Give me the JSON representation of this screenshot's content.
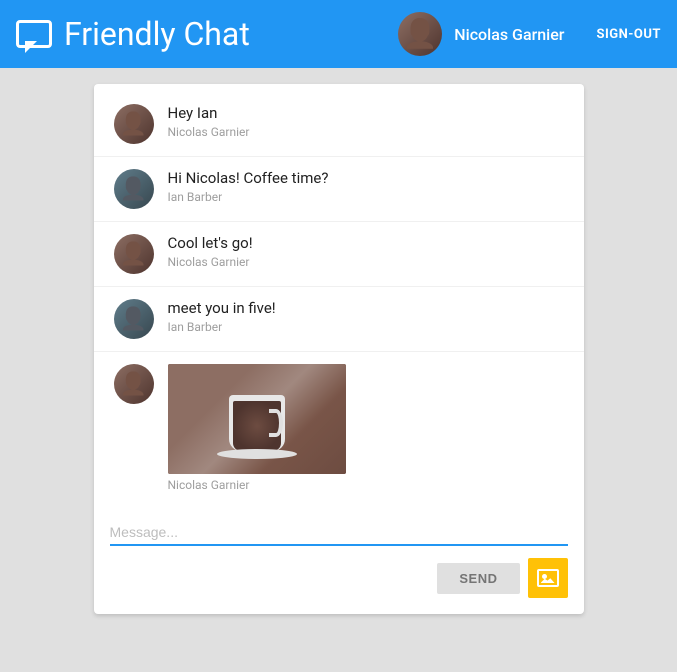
{
  "header": {
    "icon_label": "chat-icon",
    "title": "Friendly Chat",
    "user": {
      "name": "Nicolas Garnier",
      "avatar_label": "nicolas-avatar"
    },
    "sign_out_label": "SIGN-OUT"
  },
  "messages": [
    {
      "id": 1,
      "text": "Hey Ian",
      "sender": "Nicolas Garnier",
      "avatar_type": "nicolas"
    },
    {
      "id": 2,
      "text": "Hi Nicolas! Coffee time?",
      "sender": "Ian Barber",
      "avatar_type": "ian"
    },
    {
      "id": 3,
      "text": "Cool let's go!",
      "sender": "Nicolas Garnier",
      "avatar_type": "nicolas"
    },
    {
      "id": 4,
      "text": "meet you in five!",
      "sender": "Ian Barber",
      "avatar_type": "ian"
    },
    {
      "id": 5,
      "text": "",
      "sender": "Nicolas Garnier",
      "avatar_type": "nicolas",
      "has_image": true
    }
  ],
  "input": {
    "placeholder": "Message...",
    "label": "Message...",
    "send_label": "SEND"
  }
}
